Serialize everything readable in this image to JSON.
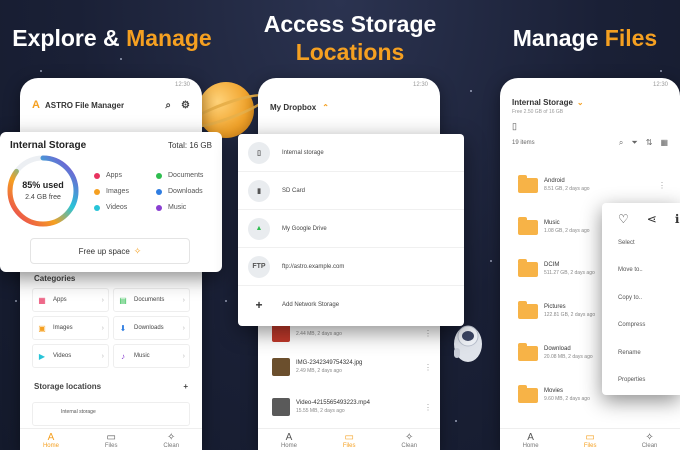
{
  "headlines": {
    "left": {
      "part1": "Explore & ",
      "part2": "Manage"
    },
    "center": {
      "line1": "Access Storage",
      "line2": "Locations"
    },
    "right": {
      "part1": "Manage ",
      "part2": "Files"
    }
  },
  "colors": {
    "accent": "#f5a021",
    "background": "#1a2036"
  },
  "status_time": "12:30",
  "phone1": {
    "app_title": "ASTRO File Manager",
    "storage_card": {
      "title": "Internal Storage",
      "total": "Total: 16 GB",
      "used_percent": "85% used",
      "used_fraction": 0.85,
      "free": "2.4 GB free",
      "legend": [
        {
          "label": "Apps",
          "color": "#e8335f"
        },
        {
          "label": "Documents",
          "color": "#2ebd4f"
        },
        {
          "label": "Images",
          "color": "#f5a021"
        },
        {
          "label": "Downloads",
          "color": "#2f7de1"
        },
        {
          "label": "Videos",
          "color": "#28c4d8"
        },
        {
          "label": "Music",
          "color": "#8a3fd1"
        }
      ],
      "free_button": "Free up space"
    },
    "categories_title": "Categories",
    "categories": [
      {
        "label": "Apps",
        "icon": "grid-icon",
        "glyph": "▦",
        "color": "#e8335f"
      },
      {
        "label": "Documents",
        "icon": "document-icon",
        "glyph": "▤",
        "color": "#2ebd4f"
      },
      {
        "label": "Images",
        "icon": "image-icon",
        "glyph": "▣",
        "color": "#f5a021"
      },
      {
        "label": "Downloads",
        "icon": "download-icon",
        "glyph": "⬇",
        "color": "#2f7de1"
      },
      {
        "label": "Videos",
        "icon": "video-icon",
        "glyph": "▶",
        "color": "#28c4d8"
      },
      {
        "label": "Music",
        "icon": "music-icon",
        "glyph": "♪",
        "color": "#8a3fd1"
      }
    ],
    "storage_locations_title": "Storage locations",
    "storage_locations_item": "Internal storage",
    "nav": [
      {
        "label": "Home",
        "icon": "astro-icon",
        "glyph": "A"
      },
      {
        "label": "Files",
        "icon": "folder-icon",
        "glyph": "▭"
      },
      {
        "label": "Clean",
        "icon": "sparkle-icon",
        "glyph": "✧"
      }
    ]
  },
  "phone2": {
    "header": "My Dropbox",
    "locations": [
      {
        "label": "Internal storage",
        "icon": "phone-icon",
        "glyph": "▯"
      },
      {
        "label": "SD Card",
        "icon": "sdcard-icon",
        "glyph": "▮"
      },
      {
        "label": "My Google Drive",
        "icon": "google-drive-icon",
        "glyph": "▲"
      },
      {
        "label": "ftp://astro.example.com",
        "icon": "ftp-icon",
        "glyph": "FTP"
      },
      {
        "label": "Add Network Storage",
        "icon": "plus-icon",
        "glyph": "+"
      }
    ],
    "files": [
      {
        "name": "",
        "meta": "2.44 MB, 2 days ago",
        "color": "#c0392b"
      },
      {
        "name": "IMG-2342349754324.jpg",
        "meta": "2.49 MB, 2 days ago",
        "color": "#6b4f2d"
      },
      {
        "name": "Video-4215565493223.mp4",
        "meta": "15.55 MB, 2 days ago",
        "color": "#5a5a5a"
      }
    ],
    "nav": [
      {
        "label": "Home",
        "icon": "astro-icon",
        "glyph": "A"
      },
      {
        "label": "Files",
        "icon": "folder-icon",
        "glyph": "▭"
      },
      {
        "label": "Clean",
        "icon": "sparkle-icon",
        "glyph": "✧"
      }
    ]
  },
  "phone3": {
    "title": "Internal Storage",
    "subtitle": "Free 2.50 GB of 16 GB",
    "item_count": "19 items",
    "folders": [
      {
        "name": "Android",
        "meta": "8.51 GB, 2 days ago"
      },
      {
        "name": "Music",
        "meta": "1.08 GB, 2 days ago"
      },
      {
        "name": "DCIM",
        "meta": "511.27 GB, 2 days ago"
      },
      {
        "name": "Pictures",
        "meta": "122.81 GB, 2 days ago"
      },
      {
        "name": "Download",
        "meta": "20.08 MB, 2 days ago"
      },
      {
        "name": "Movies",
        "meta": "9.60 MB, 2 days ago"
      }
    ],
    "context_menu": [
      "Select",
      "Move to..",
      "Copy to..",
      "Compress",
      "Rename",
      "Properties"
    ],
    "nav": [
      {
        "label": "Home",
        "icon": "astro-icon",
        "glyph": "A"
      },
      {
        "label": "Files",
        "icon": "folder-icon",
        "glyph": "▭"
      },
      {
        "label": "Clean",
        "icon": "sparkle-icon",
        "glyph": "✧"
      }
    ]
  }
}
